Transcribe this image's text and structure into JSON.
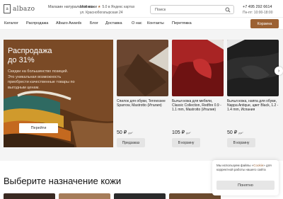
{
  "header": {
    "logo_mark": "a",
    "logo_text": "albazo",
    "tagline": "Магазин натуральной кожи",
    "city": "Москва",
    "rating": "5.0 в Яндекс картах",
    "address": "ул. Краснобогатырская 24",
    "search_placeholder": "Поиск",
    "phone": "+7 495 292 6614",
    "hours": "Пн-пт: 10:00-18:00"
  },
  "nav": {
    "items": [
      {
        "label": "Каталог"
      },
      {
        "label": "Распродажа"
      },
      {
        "label": "Albazo Awards"
      },
      {
        "label": "Блог"
      },
      {
        "label": "Доставка"
      },
      {
        "label": "О нас"
      },
      {
        "label": "Контакты"
      },
      {
        "label": "Перетяжка"
      }
    ],
    "cart_label": "Корзина"
  },
  "promo": {
    "title_line1": "Распродажа",
    "title_line2": "до 31%",
    "text": "Скидки на большинство позиций. Это уникальная возможность приобрести качественные товары по выгодным ценам.",
    "button": "Перейти"
  },
  "products": [
    {
      "name": "Спилок для обуви, Tennessee Sparrow, Mastrotto (Италия)",
      "price": "50 ₽",
      "unit": "дм²",
      "button": "Предзаказ"
    },
    {
      "name": "Бычья кожа для мебели, Classic Collection, Redfire 0.9 - 1.1 mm, Mastrotto (Италия)",
      "price": "105 ₽",
      "unit": "дм²",
      "button": "В корзину"
    },
    {
      "name": "Бычья кожа, наппа для обуви, Nappa Antique, цвет Black, 1.2 - 1.4 mm, Испания",
      "price": "50 ₽",
      "unit": "дм²",
      "button": "В корзину"
    }
  ],
  "nav_arrow": "›",
  "section_title": "Выберите назначение кожи",
  "cookie": {
    "text_before": "Мы используем файлы «",
    "link": "Cookie",
    "text_after": "» для корректной работы нашего сайта",
    "button": "Понятно"
  },
  "colors": {
    "accent": "#9c6133",
    "promo_bg": "#7c4d28",
    "section_bg": "#f4f4f4"
  }
}
